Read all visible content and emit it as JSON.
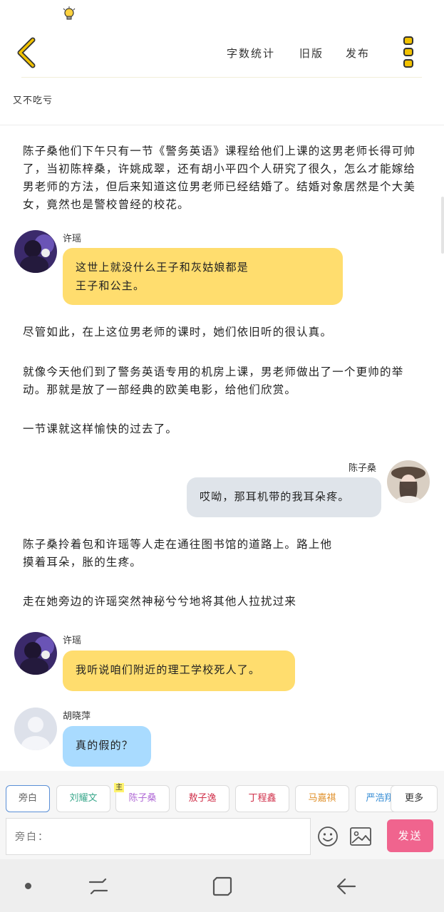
{
  "topbar": {
    "word_count": "字数统计",
    "old_version": "旧版",
    "publish": "发布"
  },
  "story": {
    "title": "又不吃亏"
  },
  "content": {
    "para1": "陈子桑他们下午只有一节《警务英语》课程给他们上课的这男老师长得可帅了，当初陈梓桑，许姚成翠，还有胡小平四个人研究了很久，怎么才能嫁给男老师的方法，但后来知道这位男老师已经结婚了。结婚对象居然是个大美女，竟然也是警校曾经的校花。",
    "msg1_speaker": "许瑶",
    "msg1_line1": "这世上就没什么王子和灰姑娘都是",
    "msg1_line2": "王子和公主。",
    "para2": "尽管如此，在上这位男老师的课时，她们依旧听的很认真。",
    "para3": "就像今天他们到了警务英语专用的机房上课，男老师做出了一个更帅的举动。那就是放了一部经典的欧美电影，给他们欣赏。",
    "para4": "一节课就这样愉快的过去了。",
    "msg2_speaker": "陈子桑",
    "msg2_text": "哎呦，那耳机带的我耳朵疼。",
    "para5_line1": "陈子桑拎着包和许瑶等人走在通往图书馆的道路上。路上他",
    "para5_line2": "摸着耳朵，胀的生疼。",
    "para6": "走在她旁边的许瑶突然神秘兮兮地将其他人拉扰过来",
    "msg3_speaker": "许瑶",
    "msg3_text": "我听说咱们附近的理工学校死人了。",
    "msg4_speaker": "胡晓萍",
    "msg4_text": "真的假的？"
  },
  "characters": [
    {
      "label": "旁白",
      "color": "#666666"
    },
    {
      "label": "刘耀文",
      "color": "#3aa88c"
    },
    {
      "label": "陈子桑",
      "color": "#b06ad6"
    },
    {
      "label": "敖子逸",
      "color": "#d0304a"
    },
    {
      "label": "丁程鑫",
      "color": "#d0304a"
    },
    {
      "label": "马嘉祺",
      "color": "#e0902a"
    },
    {
      "label": "严浩翔",
      "color": "#3a8fd6"
    }
  ],
  "main_tag": "主",
  "more_label": "更多",
  "input": {
    "placeholder": "旁白："
  },
  "send_label": "发送",
  "colors": {
    "yellow_bubble": "#ffdd6e",
    "grey_bubble": "#dfe4ea",
    "blue_bubble": "#a9dbff",
    "send": "#f0648e",
    "accent": "#f2c200"
  }
}
